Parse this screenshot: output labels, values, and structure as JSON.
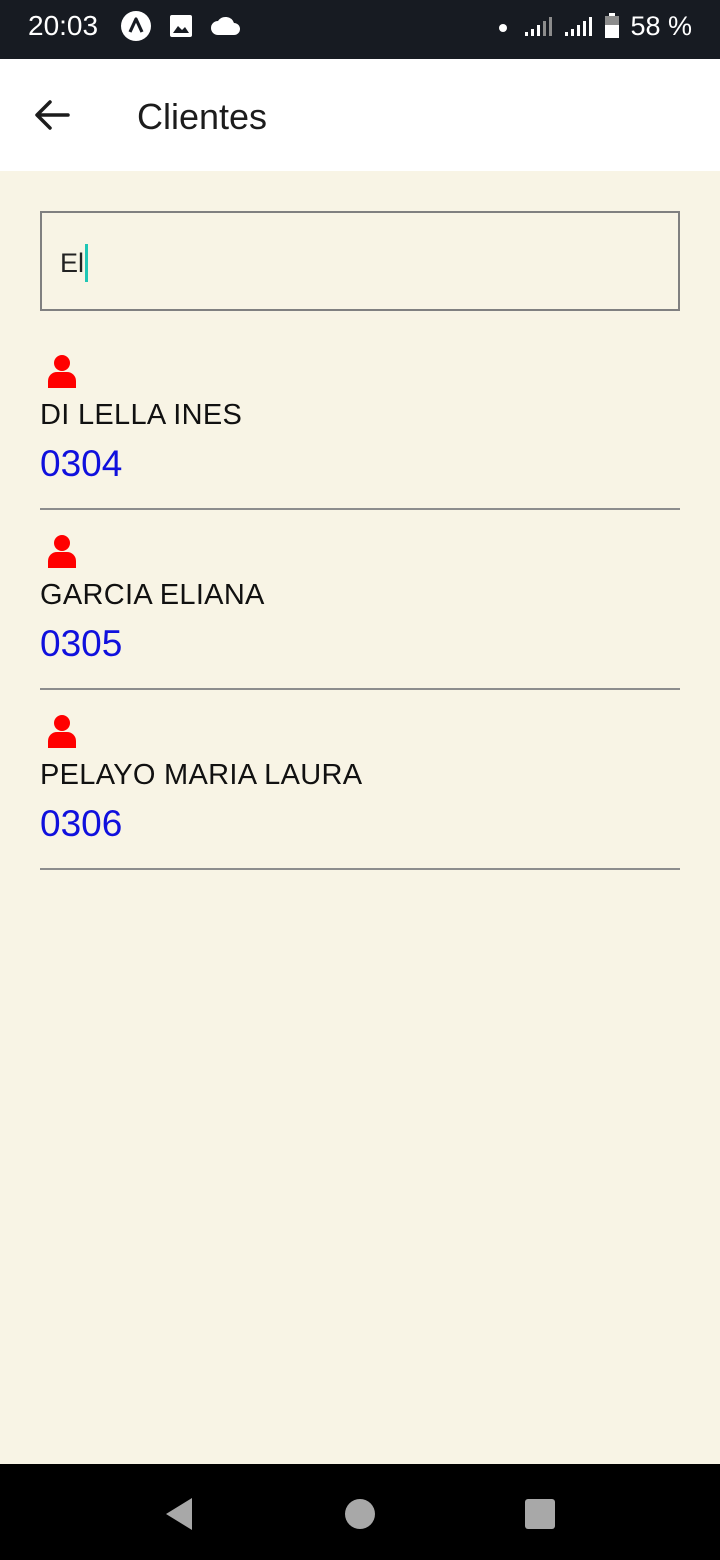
{
  "status_bar": {
    "time": "20:03",
    "battery": "58 %",
    "icons": [
      "app-icon",
      "image-icon",
      "cloud-icon",
      "dot-icon",
      "signal-icon",
      "signal-icon",
      "battery-icon"
    ]
  },
  "app_bar": {
    "title": "Clientes",
    "back_icon": "arrow-left-icon"
  },
  "search": {
    "value": "El"
  },
  "clients": [
    {
      "name": "DI LELLA INES",
      "code": "0304",
      "icon": "person-icon"
    },
    {
      "name": "GARCIA ELIANA",
      "code": "0305",
      "icon": "person-icon"
    },
    {
      "name": "PELAYO MARIA LAURA",
      "code": "0306",
      "icon": "person-icon"
    }
  ],
  "colors": {
    "background": "#f8f4e5",
    "status_bar": "#171b22",
    "person_icon": "#ff0000",
    "code_text": "#1010dd",
    "caret": "#1fc6b5"
  },
  "nav_bar": {
    "buttons": [
      "back-triangle-icon",
      "home-circle-icon",
      "recents-square-icon"
    ]
  }
}
